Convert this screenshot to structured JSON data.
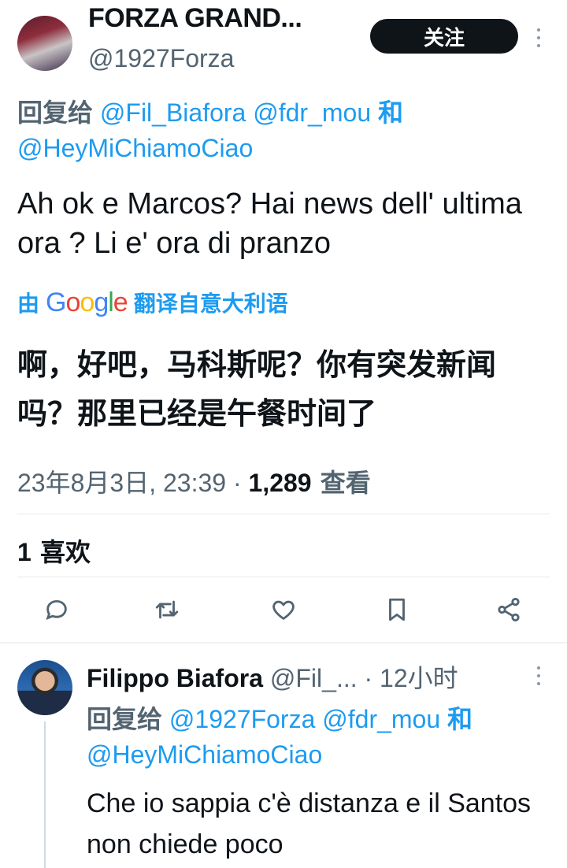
{
  "tweet": {
    "author_name": "FORZA GRAND...",
    "author_handle": "@1927Forza",
    "follow_label": "关注",
    "reply_prefix": "回复给",
    "mention_1": "@Fil_Biafora",
    "mention_2": "@fdr_mou",
    "and_word": "和",
    "mention_3": "@HeyMiChiamoCiao",
    "text": "Ah ok e Marcos? Hai news dell' ultima ora ? Li e' ora di pranzo",
    "translate_by": "由",
    "translate_brand": "Google",
    "translate_from": "翻译自意大利语",
    "translated_text": "啊，好吧，马科斯呢？你有突发新闻吗？那里已经是午餐时间了",
    "date": "23年8月3日, 23:39 · ",
    "views_count": "1,289",
    "views_label": " 查看",
    "likes_count": "1",
    "likes_label": " 喜欢"
  },
  "reply": {
    "author_name": "Filippo Biafora",
    "author_handle": " @Fil_... · 12小时",
    "reply_prefix": "回复给",
    "mention_1": "@1927Forza",
    "mention_2": "@fdr_mou",
    "and_word": "和",
    "mention_3": "@HeyMiChiamoCiao",
    "text": "Che io sappia c'è distanza e il Santos non chiede poco"
  },
  "actions": [
    "reply-icon",
    "retweet-icon",
    "like-icon",
    "bookmark-icon",
    "share-icon"
  ],
  "colors": {
    "link": "#1d9bf0",
    "muted": "#536471",
    "text": "#0f1419",
    "button": "#0f1419"
  }
}
